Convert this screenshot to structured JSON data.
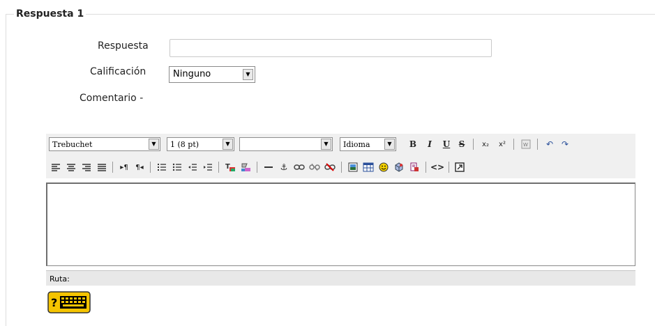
{
  "section": {
    "legend": "Respuesta 1"
  },
  "form": {
    "answer_label": "Respuesta",
    "answer_value": "",
    "grade_label": "Calificación",
    "grade_selected": "Ninguno",
    "feedback_label": "Comentario -"
  },
  "toolbar": {
    "font_family": "Trebuchet",
    "font_size": "1 (8 pt)",
    "format": "",
    "language": "Idioma"
  },
  "status": {
    "path_label": "Ruta:"
  },
  "icons": [
    "bold-icon",
    "italic-icon",
    "underline-icon",
    "strikethrough-icon",
    "subscript-icon",
    "superscript-icon",
    "paste-word-icon",
    "undo-icon",
    "redo-icon",
    "align-left-icon",
    "align-center-icon",
    "align-right-icon",
    "justify-icon",
    "ltr-icon",
    "rtl-icon",
    "ordered-list-icon",
    "unordered-list-icon",
    "outdent-icon",
    "indent-icon",
    "text-color-icon",
    "background-color-icon",
    "horizontal-rule-icon",
    "anchor-icon",
    "link-icon",
    "unlink-icon",
    "nolink-icon",
    "image-icon",
    "table-icon",
    "smiley-icon",
    "special-char-icon",
    "search-replace-icon",
    "html-source-icon",
    "fullscreen-icon",
    "keyboard-icon"
  ],
  "colors": {
    "border": "#dddddd",
    "toolbar_bg": "#f0f0f0",
    "keyboard_badge": "#f5c400"
  }
}
